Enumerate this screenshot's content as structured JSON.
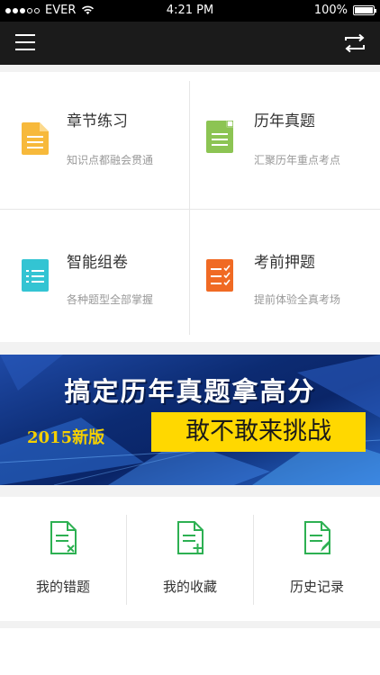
{
  "status": {
    "carrier": "EVER",
    "time": "4:21 PM",
    "battery": "100%"
  },
  "nav": {
    "menu_icon": "menu-icon",
    "switch_icon": "switch-icon"
  },
  "grid": [
    {
      "title": "章节练习",
      "subtitle": "知识点都融会贯通",
      "icon": "document-icon",
      "color": "#f7b93b"
    },
    {
      "title": "历年真题",
      "subtitle": "汇聚历年重点考点",
      "icon": "document-folded-icon",
      "color": "#8cc453"
    },
    {
      "title": "智能组卷",
      "subtitle": "各种题型全部掌握",
      "icon": "list-icon",
      "color": "#33c4d3"
    },
    {
      "title": "考前押题",
      "subtitle": "提前体验全真考场",
      "icon": "checklist-icon",
      "color": "#f06a24"
    }
  ],
  "banner": {
    "title": "搞定历年真题拿高分",
    "year": "2015新版",
    "cta": "敢不敢来挑战"
  },
  "bottom": [
    {
      "label": "我的错题",
      "icon": "wrong-doc-icon"
    },
    {
      "label": "我的收藏",
      "icon": "add-doc-icon"
    },
    {
      "label": "历史记录",
      "icon": "edit-doc-icon"
    }
  ],
  "colors": {
    "accent_green": "#2db052",
    "nav_bg": "#1b1b1b"
  }
}
